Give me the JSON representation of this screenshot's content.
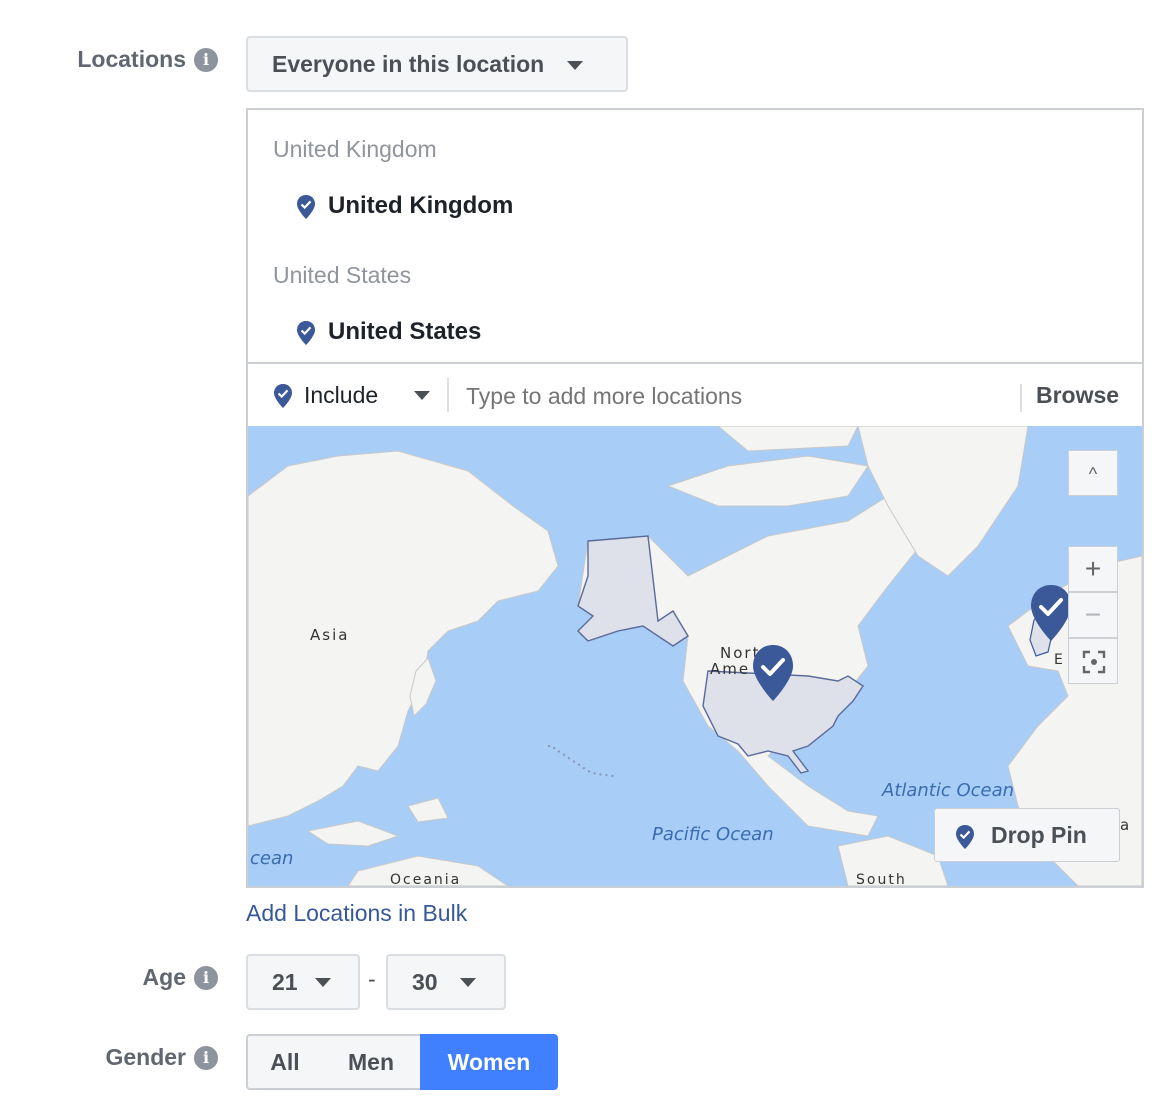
{
  "locations": {
    "label": "Locations",
    "dropdown_label": "Everyone in this location",
    "groups": [
      {
        "header": "United Kingdom",
        "item": "United Kingdom"
      },
      {
        "header": "United States",
        "item": "United States"
      }
    ],
    "include_label": "Include",
    "search_placeholder": "Type to add more locations",
    "browse_label": "Browse",
    "add_bulk_link": "Add Locations in Bulk"
  },
  "map": {
    "labels": {
      "asia": "Asia",
      "north_america_1": "Nort",
      "north_america_2": "Ame",
      "atlantic": "Atlantic Ocean",
      "pacific": "Pacific Ocean",
      "ocean_left": "cean",
      "oceania": "Oceania",
      "south": "South",
      "europe_fragment": "E",
      "africa_fragment": "a"
    },
    "collapse_icon": "^",
    "zoom_in": "+",
    "zoom_out": "−",
    "drop_pin_label": "Drop Pin",
    "colors": {
      "water": "#a8cdf6",
      "land": "#f4f4f2",
      "selected": "#dfe1ea",
      "pin": "#3b5998"
    }
  },
  "age": {
    "label": "Age",
    "min": "21",
    "separator": "-",
    "max": "30"
  },
  "gender": {
    "label": "Gender",
    "options": [
      "All",
      "Men",
      "Women"
    ],
    "selected": "Women",
    "selected_color": "#4080ff"
  }
}
